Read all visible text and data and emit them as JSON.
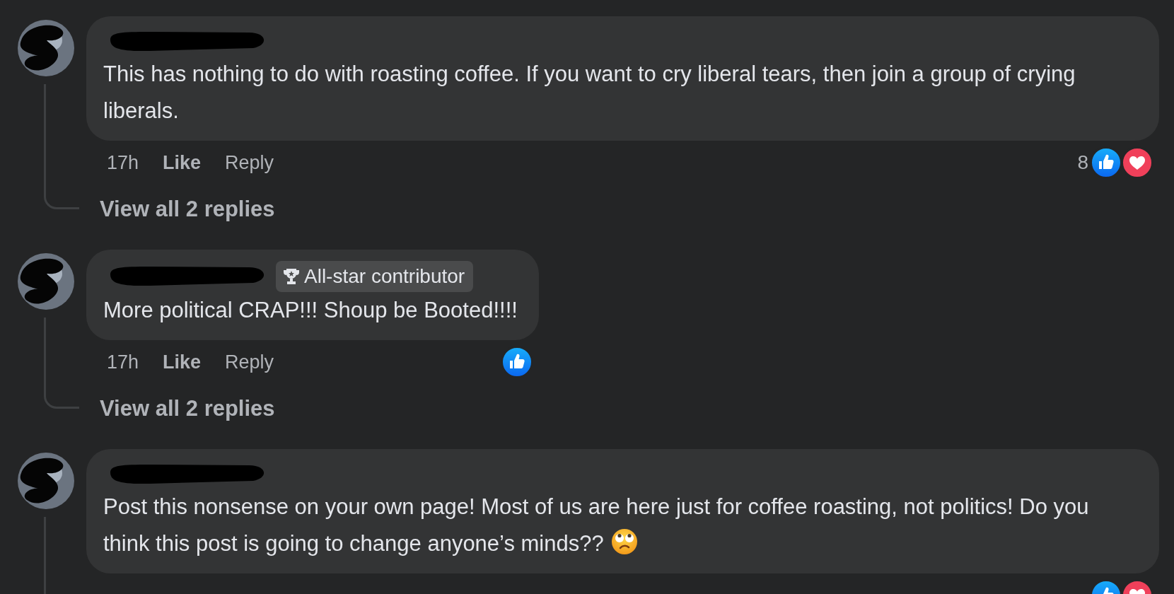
{
  "comments": [
    {
      "redacted_name": true,
      "text": "This has nothing to do with roasting coffee. If you want to cry liberal tears, then join a group of crying liberals.",
      "time": "17h",
      "like": "Like",
      "reply": "Reply",
      "reaction_count": "8",
      "reactions": [
        {
          "kind": "like"
        },
        {
          "kind": "love"
        }
      ],
      "has_replies": true,
      "view_replies": "View all 2 replies"
    },
    {
      "redacted_name": true,
      "badge": "All-star contributor",
      "text": "More political CRAP!!! Shoup be Booted!!!!",
      "time": "17h",
      "like": "Like",
      "reply": "Reply",
      "reactions": [
        {
          "kind": "like"
        }
      ],
      "has_replies": true,
      "view_replies": "View all 2 replies"
    },
    {
      "redacted_name": true,
      "text": "Post this nonsense on your own page! Most of us are here just for coffee roasting, not politics! Do you think this post is going to change anyone’s minds??",
      "emoji_end": true,
      "reactions": [
        {
          "kind": "like"
        },
        {
          "kind": "love"
        }
      ],
      "has_replies": true
    }
  ]
}
